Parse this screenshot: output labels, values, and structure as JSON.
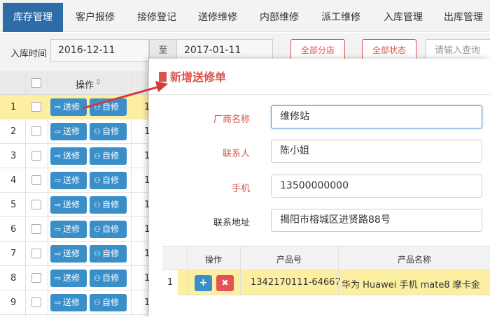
{
  "tabs": [
    {
      "label": "库存管理",
      "active": true
    },
    {
      "label": "客户报修",
      "active": false
    },
    {
      "label": "接修登记",
      "active": false
    },
    {
      "label": "送修维修",
      "active": false
    },
    {
      "label": "内部维修",
      "active": false
    },
    {
      "label": "派工维修",
      "active": false
    },
    {
      "label": "入库管理",
      "active": false
    },
    {
      "label": "出库管理",
      "active": false
    }
  ],
  "filter": {
    "label": "入库时间",
    "date_from": "2016-12-11",
    "to_label": "至",
    "date_to": "2017-01-11",
    "branch_btn": "全部分店",
    "status_btn": "全部状态",
    "search_placeholder": "请输入查询"
  },
  "grid": {
    "header_op": "操作",
    "send_label": "送修",
    "self_label": "自修",
    "rows": [
      "1",
      "2",
      "3",
      "4",
      "5",
      "6",
      "7",
      "8",
      "9"
    ],
    "extra_col": "1"
  },
  "modal": {
    "title": "新增送修单",
    "fields": {
      "vendor_label": "厂商名称",
      "vendor_value": "维修站",
      "contact_label": "联系人",
      "contact_value": "陈小姐",
      "phone_label": "手机",
      "phone_value": "13500000000",
      "address_label": "联系地址",
      "address_value": "揭阳市榕城区进贤路88号"
    },
    "table": {
      "headers": [
        "操作",
        "产品号",
        "产品名称"
      ],
      "rows": [
        {
          "index": "1",
          "product_no": "1342170111-64667",
          "product_name": "华为 Huawei 手机 mate8 摩卡金"
        }
      ]
    }
  },
  "colors": {
    "primary": "#2d6ca6",
    "button_blue": "#3a8fc9",
    "accent_red": "#d9534f",
    "highlight": "#fcefa1"
  }
}
